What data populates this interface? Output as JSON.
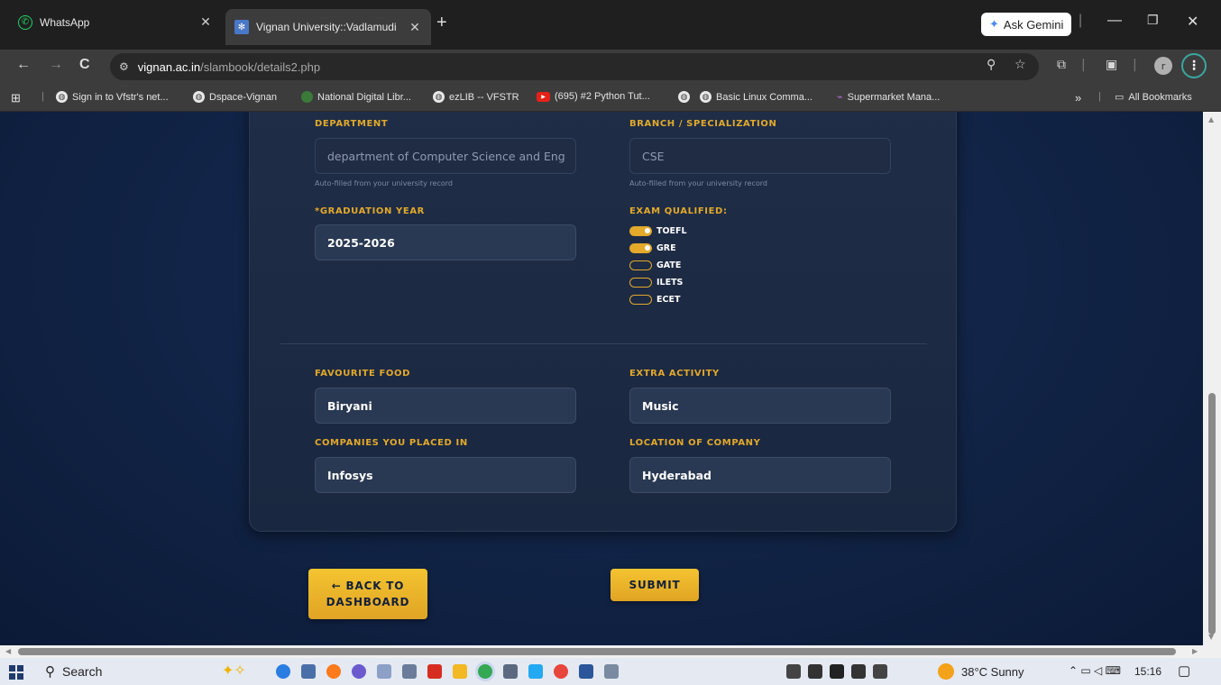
{
  "browser": {
    "tabs": [
      {
        "title": "WhatsApp",
        "active": false
      },
      {
        "title": "Vignan University::Vadlamudi",
        "active": true
      }
    ],
    "gemini_label": "Ask Gemini",
    "url_host": "vignan.ac.in",
    "url_path": "/slambook/details2.php",
    "profile_initial": "r",
    "bookmarks": [
      "Sign in to Vfstr's net...",
      "Dspace-Vignan",
      "National Digital Libr...",
      "ezLIB -- VFSTR",
      "(695) #2 Python Tut...",
      "Basic Linux Comma...",
      "Supermarket Mana..."
    ],
    "all_bookmarks": "All Bookmarks",
    "more_chevron": "»"
  },
  "form": {
    "department": {
      "label": "DEPARTMENT",
      "value": "department of Computer Science and Eng",
      "hint": "Auto-filled from your university record"
    },
    "branch": {
      "label": "BRANCH / SPECIALIZATION",
      "value": "CSE",
      "hint": "Auto-filled from your university record"
    },
    "graduation_year": {
      "label": "*GRADUATION YEAR",
      "value": "2025-2026"
    },
    "exams": {
      "label": "EXAM QUALIFIED:",
      "options": [
        {
          "name": "TOEFL",
          "checked": true
        },
        {
          "name": "GRE",
          "checked": true
        },
        {
          "name": "GATE",
          "checked": false
        },
        {
          "name": "ILETS",
          "checked": false
        },
        {
          "name": "ECET",
          "checked": false
        }
      ]
    },
    "favourite_food": {
      "label": "FAVOURITE FOOD",
      "value": "Biryani"
    },
    "extra_activity": {
      "label": "EXTRA ACTIVITY",
      "value": "Music"
    },
    "companies": {
      "label": "COMPANIES YOU PLACED IN",
      "value": "Infosys"
    },
    "location": {
      "label": "LOCATION OF COMPANY",
      "value": "Hyderabad"
    }
  },
  "buttons": {
    "back_line1": "← BACK TO",
    "back_line2": "DASHBOARD",
    "submit": "SUBMIT"
  },
  "taskbar": {
    "search_label": "Search",
    "weather": "38°C  Sunny",
    "time": "15:16"
  },
  "colors": {
    "accent": "#e2a92b",
    "button": "#f4c430",
    "page_bg": "#13264a",
    "card_bg": "#1f2d47"
  }
}
